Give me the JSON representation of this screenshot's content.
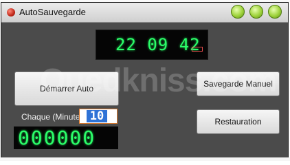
{
  "window": {
    "title": "AutoSauvegarde"
  },
  "clock": {
    "time": "22 09 42"
  },
  "buttons": {
    "auto": "Démarrer Auto",
    "manual": "Savegarde Manuel",
    "restore": "Restauration"
  },
  "interval": {
    "label": "Chaque (Minute)",
    "value": "10"
  },
  "counter": {
    "value": "000000"
  },
  "watermark": "Ouedkniss.com",
  "colors": {
    "lcd": "#2bff6a",
    "window_bg": "#4b4b4b"
  }
}
